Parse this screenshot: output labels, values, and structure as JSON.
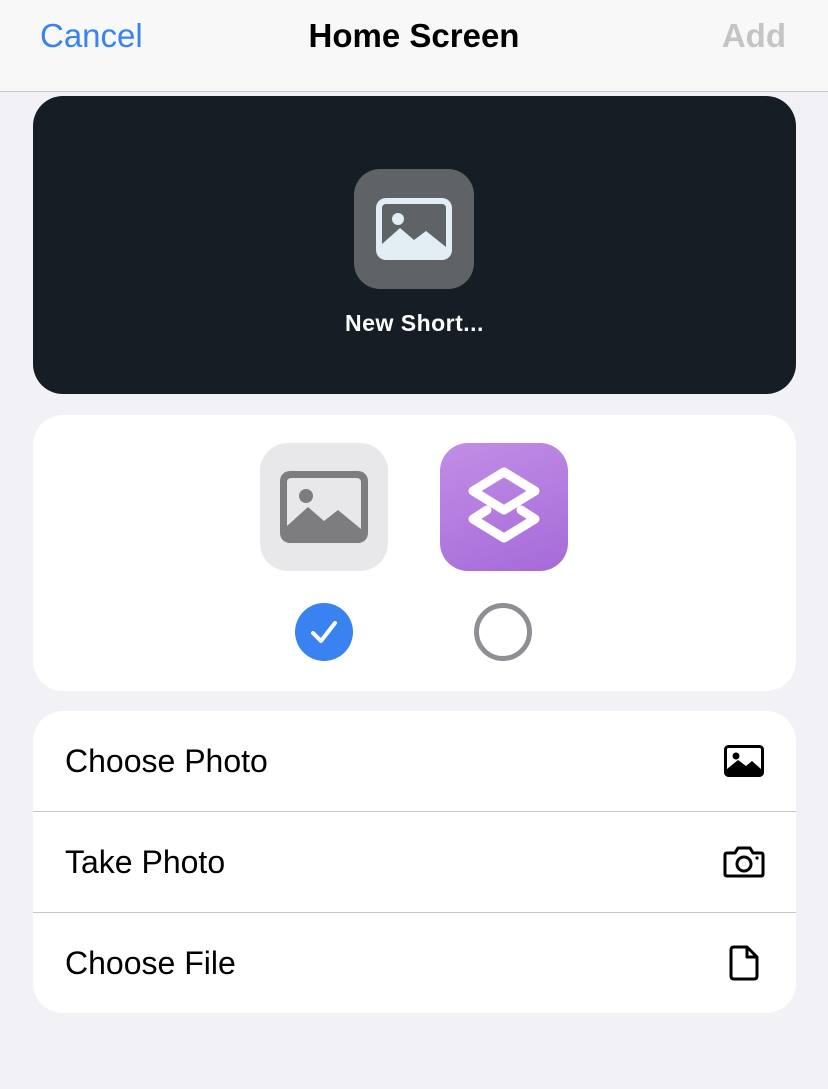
{
  "navbar": {
    "cancel_label": "Cancel",
    "title": "Home Screen",
    "add_label": "Add"
  },
  "preview": {
    "icon": "photo-icon",
    "label": "New Short..."
  },
  "icon_choices": {
    "items": [
      {
        "icon": "photo-icon",
        "selected": true
      },
      {
        "icon": "shortcuts-app-icon",
        "selected": false
      }
    ]
  },
  "menu": {
    "items": [
      {
        "label": "Choose Photo",
        "icon": "photo-icon"
      },
      {
        "label": "Take Photo",
        "icon": "camera-icon"
      },
      {
        "label": "Choose File",
        "icon": "document-icon"
      }
    ]
  },
  "colors": {
    "accent": "#3a82f0",
    "disabled": "#c4c4c6",
    "preview_background": "#161d24",
    "shortcuts_purple": "#a66ad8"
  }
}
